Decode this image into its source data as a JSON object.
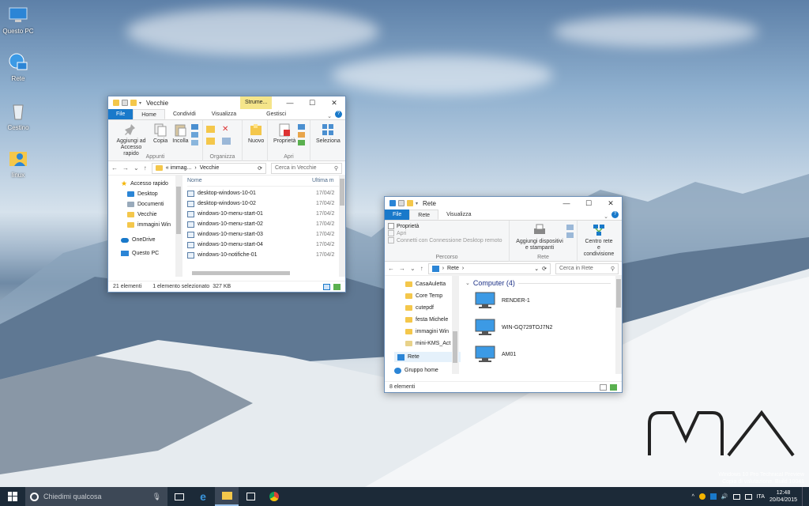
{
  "desktop": {
    "icons": [
      {
        "label": "Questo PC"
      },
      {
        "label": "Rete"
      },
      {
        "label": "Cestino"
      },
      {
        "label": "linux"
      }
    ]
  },
  "window1": {
    "title": "Vecchie",
    "context_tab": "Strume...",
    "context_subtab": "Gestisci",
    "tabs": [
      "File",
      "Home",
      "Condividi",
      "Visualizza"
    ],
    "ribbon": {
      "clipboard": {
        "pin": "Aggiungi ad Accesso rapido",
        "copy": "Copia",
        "paste": "Incolla",
        "label": "Appunti"
      },
      "organize_label": "Organizza",
      "new": "Nuovo",
      "open": {
        "properties": "Proprietà",
        "label": "Apri"
      },
      "select": "Seleziona"
    },
    "address": {
      "path1": "« immag...",
      "path2": "Vecchie"
    },
    "search_placeholder": "Cerca in Vecchie",
    "nav": [
      {
        "label": "Accesso rapido"
      },
      {
        "label": "Desktop"
      },
      {
        "label": "Documenti"
      },
      {
        "label": "Vecchie"
      },
      {
        "label": "immagini Win"
      },
      {
        "label": "OneDrive"
      },
      {
        "label": "Questo PC"
      }
    ],
    "columns": {
      "name": "Nome",
      "modified": "Ultima m"
    },
    "files": [
      {
        "name": "desktop-windows-10-01",
        "date": "17/04/2"
      },
      {
        "name": "desktop-windows-10-02",
        "date": "17/04/2"
      },
      {
        "name": "windows-10-menu-start-01",
        "date": "17/04/2"
      },
      {
        "name": "windows-10-menu-start-02",
        "date": "17/04/2"
      },
      {
        "name": "windows-10-menu-start-03",
        "date": "17/04/2"
      },
      {
        "name": "windows-10-menu-start-04",
        "date": "17/04/2"
      },
      {
        "name": "windows-10-notifiche-01",
        "date": "17/04/2"
      }
    ],
    "status": {
      "count": "21 elementi",
      "selected": "1 elemento selezionato",
      "size": "327 KB"
    }
  },
  "window2": {
    "title": "Rete",
    "tabs": [
      "File",
      "Rete",
      "Visualizza"
    ],
    "ribbon": {
      "properties": "Proprietà",
      "open": "Apri",
      "rdp": "Connetti con Connessione Desktop remoto",
      "group1_label": "Percorso",
      "add_devices": "Aggiungi dispositivi e stampanti",
      "network_center": "Centro rete e condivisione",
      "group2_label": "Rete"
    },
    "address": {
      "path": "Rete"
    },
    "search_placeholder": "Cerca in Rete",
    "nav": [
      {
        "label": "CasaAuletta"
      },
      {
        "label": "Core Temp"
      },
      {
        "label": "cutepdf"
      },
      {
        "label": "festa Michele"
      },
      {
        "label": "immagini Win"
      },
      {
        "label": "mini-KMS_Act"
      },
      {
        "label": "Rete"
      },
      {
        "label": "Gruppo home"
      }
    ],
    "group_header": "Computer (4)",
    "computers": [
      {
        "name": "RENDER-1"
      },
      {
        "name": "WIN-GQ729TOJ7N2"
      },
      {
        "name": "AM01"
      }
    ],
    "status": {
      "count": "8 elementi"
    }
  },
  "watermark": {
    "line1": "Windows 10 Pro Technical Preview",
    "line2": "Copia di valutazione. Build 10041"
  },
  "taskbar": {
    "search_placeholder": "Chiedimi qualcosa",
    "lang": "ITA",
    "time": "12:48",
    "date": "20/04/2015"
  },
  "colors": {
    "accent": "#1979ca",
    "taskbar": "#1c2a38",
    "folder": "#f4c74b"
  }
}
